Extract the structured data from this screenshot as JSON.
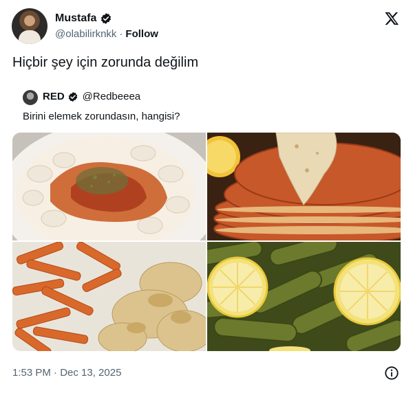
{
  "author": {
    "name": "Mustafa",
    "handle": "@olabilirknkk",
    "separator": "·",
    "follow_label": "Follow",
    "verified": true
  },
  "tweet": {
    "text": "Hiçbir şey için zorunda değilim",
    "timestamp": "1:53 PM · Dec 13, 2025"
  },
  "quoted": {
    "name": "RED",
    "handle": "@Redbeeea",
    "verified": true,
    "text": "Birini elemek zorundasın, hangisi?"
  },
  "icons": {
    "close": "x-logo-icon",
    "info": "info-icon",
    "verified": "verified-badge-icon"
  },
  "colors": {
    "text": "#0f1419",
    "secondary": "#536471",
    "verified": "#0f1419"
  }
}
